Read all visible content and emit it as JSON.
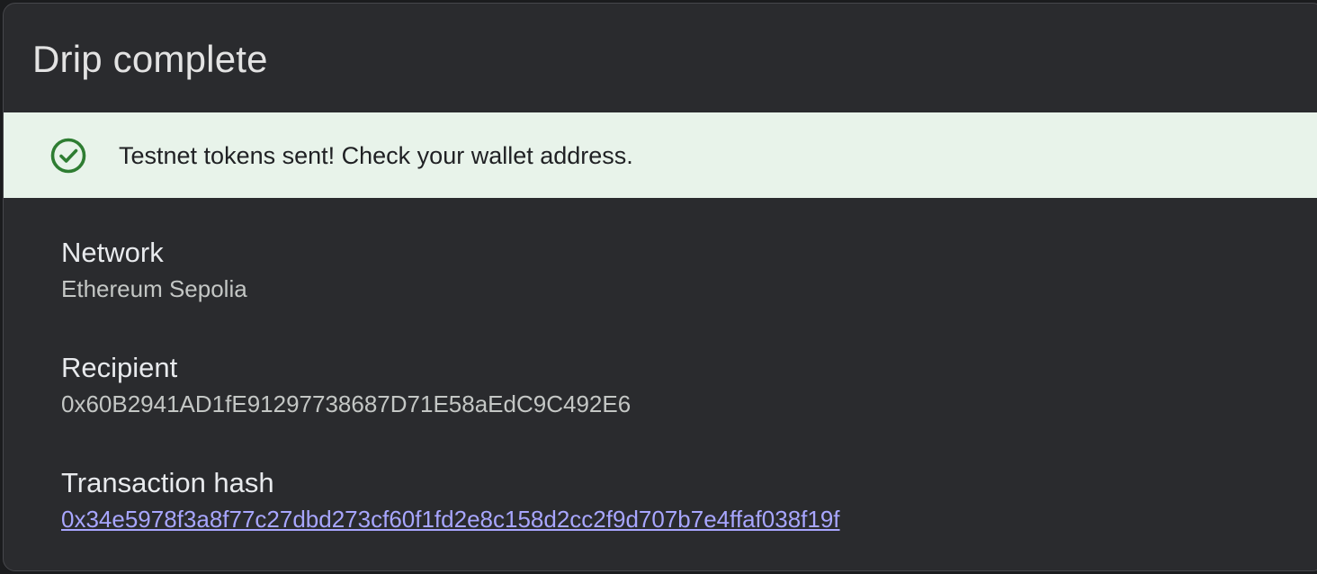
{
  "dialog": {
    "title": "Drip complete"
  },
  "banner": {
    "icon": "check-circle-icon",
    "message": "Testnet tokens sent! Check your wallet address.",
    "color": "#2e7d32",
    "background": "#e8f3ea"
  },
  "details": {
    "network_label": "Network",
    "network_value": "Ethereum Sepolia",
    "recipient_label": "Recipient",
    "recipient_value": "0x60B2941AD1fE91297738687D71E58aEdC9C492E6",
    "tx_label": "Transaction hash",
    "tx_value": "0x34e5978f3a8f77c27dbd273cf60f1fd2e8c158d2cc2f9d707b7e4ffaf038f19f"
  },
  "colors": {
    "dialog_background": "#2a2b2e",
    "link": "#a8a6ff"
  }
}
